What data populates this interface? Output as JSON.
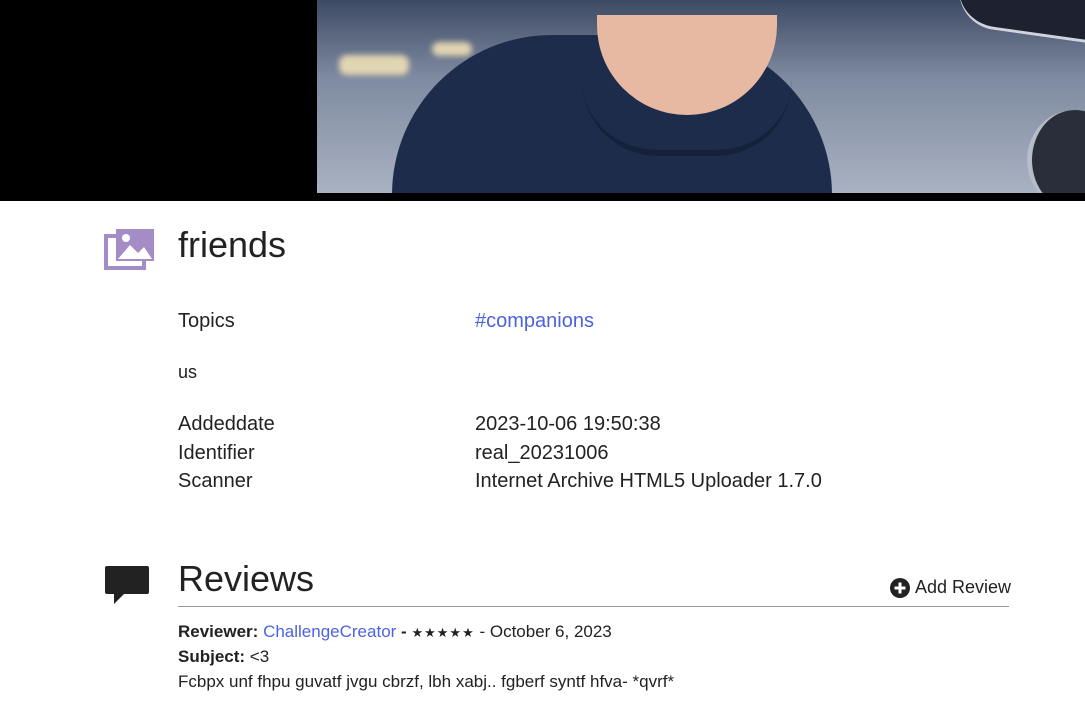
{
  "item": {
    "title": "friends",
    "icon": "image-gallery-icon"
  },
  "metadata": {
    "topics_label": "Topics",
    "topics_value": "#companions",
    "description": "us",
    "rows": [
      {
        "label": "Addeddate",
        "value": "2023-10-06 19:50:38"
      },
      {
        "label": "Identifier",
        "value": "real_20231006"
      },
      {
        "label": "Scanner",
        "value": "Internet Archive HTML5 Uploader 1.7.0"
      }
    ]
  },
  "reviews": {
    "title": "Reviews",
    "icon": "speech-bubble-icon",
    "add_label": "Add Review",
    "entries": [
      {
        "reviewer_label": "Reviewer:",
        "reviewer": "ChallengeCreator",
        "separator": "-",
        "stars": "★★★★★",
        "rating": 5,
        "date": "- October 6, 2023",
        "subject_label": "Subject:",
        "subject": "<3",
        "body": "Fcbpx unf fhpu guvatf jvgu cbrzf, lbh xabj.. fgberf syntf hfva- *qvrf*"
      }
    ]
  },
  "colors": {
    "link": "#4b64de",
    "icon_purple": "#a48dc6",
    "text": "#222222"
  }
}
